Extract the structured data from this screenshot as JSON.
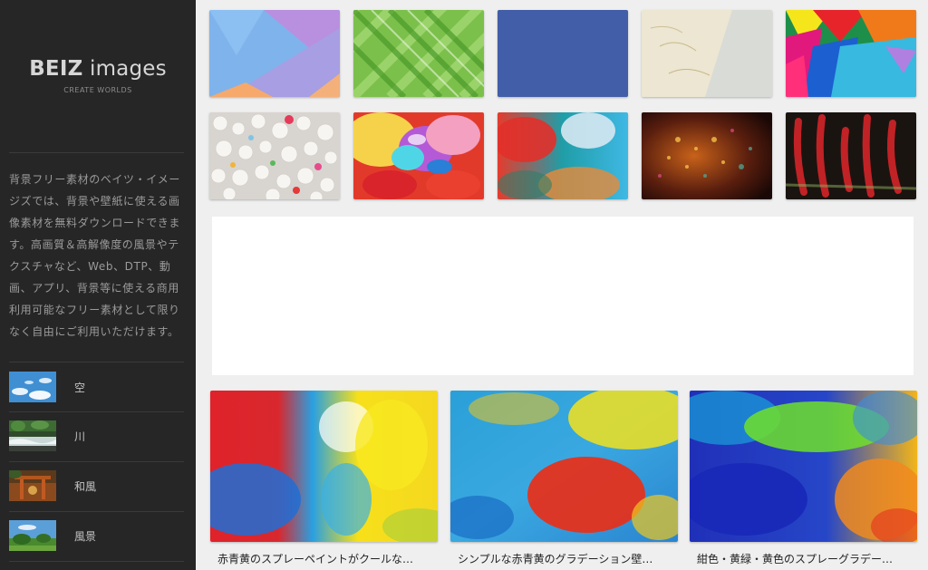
{
  "brand": {
    "name_bold": "BEIZ",
    "name_rest": " images",
    "tagline": "CREATE WORLDS"
  },
  "description": "背景フリー素材のベイツ・イメージズでは、背景や壁紙に使える画像素材を無料ダウンロードできます。高画質＆高解像度の風景やテクスチャなど、Web、DTP、動画、アプリ、背景等に使える商用利用可能なフリー素材として限りなく自由にご利用いただけます。",
  "categories": [
    {
      "label": "空"
    },
    {
      "label": "川"
    },
    {
      "label": "和風"
    },
    {
      "label": "風景"
    }
  ],
  "cards": [
    {
      "caption": "赤青黄のスプレーペイントがクールな…"
    },
    {
      "caption": "シンプルな赤青黄のグラデーション壁…"
    },
    {
      "caption": "紺色・黄緑・黄色のスプレーグラデー…"
    }
  ],
  "colors": {
    "sidebar_bg": "#262626",
    "page_bg": "#efefef"
  }
}
